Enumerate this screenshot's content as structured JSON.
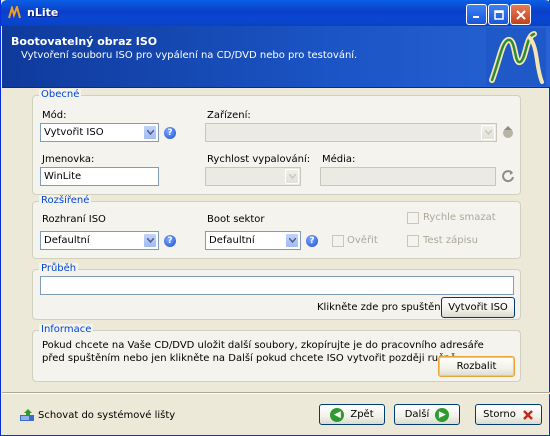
{
  "window": {
    "title": "nLite"
  },
  "header": {
    "title": "Bootovatelný obraz ISO",
    "subtitle": "Vytvoření souboru ISO pro vypálení na CD/DVD nebo pro testování."
  },
  "obecne": {
    "group_label": "Obecné",
    "mode_label": "Mód:",
    "mode_value": "Vytvořit ISO",
    "device_label": "Zařízení:",
    "device_value": "",
    "name_label": "Jmenovka:",
    "name_value": "WinLite",
    "speed_label": "Rychlost vypalování:",
    "speed_value": "",
    "media_label": "Média:",
    "media_value": ""
  },
  "rozsirene": {
    "group_label": "Rozšířené",
    "iso_interface_label": "Rozhraní ISO",
    "iso_interface_value": "Defaultní",
    "boot_sector_label": "Boot sektor",
    "boot_sector_value": "Defaultní",
    "verify_label": "Ověřit",
    "quick_erase_label": "Rychle smazat",
    "test_write_label": "Test zápisu"
  },
  "prubeh": {
    "group_label": "Průběh",
    "hint": "Klikněte zde pro spuštění ->",
    "create_iso_button": "Vytvořit ISO"
  },
  "informace": {
    "group_label": "Informace",
    "line1": "Pokud chcete na Vaše CD/DVD uložit další soubory, zkopírujte je do pracovního adresáře",
    "line2": "před spuštěním nebo jen klikněte na Další pokud chcete ISO vytvořit později ručně.",
    "unpack_button": "Rozbalit"
  },
  "footer": {
    "tray_label": "Schovat do systémové lišty",
    "back_button": "Zpět",
    "next_button": "Další",
    "cancel_button": "Storno"
  }
}
